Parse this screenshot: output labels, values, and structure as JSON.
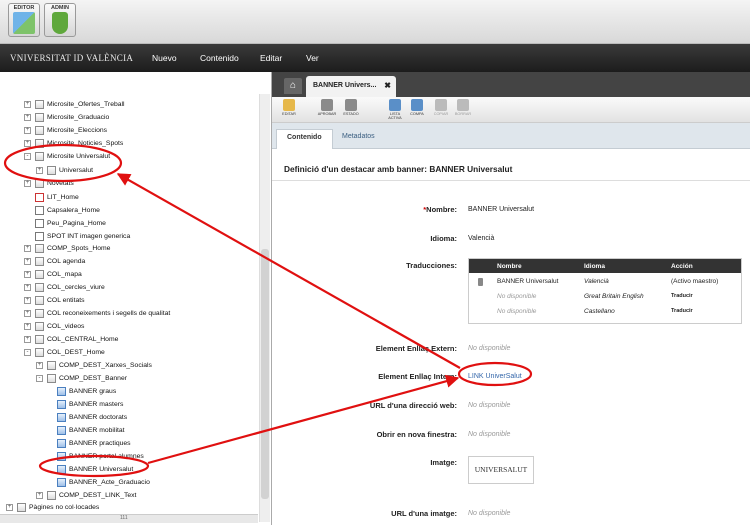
{
  "apps": [
    {
      "label": "EDITOR",
      "icon": "editor-icon"
    },
    {
      "label": "ADMIN",
      "icon": "admin-shield-icon"
    }
  ],
  "brand": "VNIVERSITAT ID VALÈNCIA",
  "menu": [
    "Nuevo",
    "Contenido",
    "Editar",
    "Ver"
  ],
  "tree": [
    {
      "label": "Microsite_Ofertes_Treball",
      "expander": "+",
      "icon": "page"
    },
    {
      "label": "Microsite_Graduacio",
      "expander": "+",
      "icon": "page"
    },
    {
      "label": "Microsite_Eleccions",
      "expander": "+",
      "icon": "page"
    },
    {
      "label": "Microsite_Noticies_Spots",
      "expander": "+",
      "icon": "page"
    },
    {
      "label": "Microsite Universalut",
      "expander": "-",
      "icon": "page"
    },
    {
      "label": "Universalut",
      "expander": "+",
      "icon": "page"
    },
    {
      "label": "Novetats",
      "expander": "+",
      "icon": "page"
    },
    {
      "label": "LIT_Home",
      "expander": "",
      "icon": "red"
    },
    {
      "label": "Capsalera_Home",
      "expander": "",
      "icon": "doc"
    },
    {
      "label": "Peu_Pagina_Home",
      "expander": "",
      "icon": "doc"
    },
    {
      "label": "SPOT INT imagen generica",
      "expander": "",
      "icon": "doc"
    },
    {
      "label": "COMP_Spots_Home",
      "expander": "+",
      "icon": "page"
    },
    {
      "label": "COL agenda",
      "expander": "+",
      "icon": "page"
    },
    {
      "label": "COL_mapa",
      "expander": "+",
      "icon": "page"
    },
    {
      "label": "COL_cercles_viure",
      "expander": "+",
      "icon": "page"
    },
    {
      "label": "COL entitats",
      "expander": "+",
      "icon": "page"
    },
    {
      "label": "COL reconeixements i segells de qualitat",
      "expander": "+",
      "icon": "page"
    },
    {
      "label": "COL_videos",
      "expander": "+",
      "icon": "page"
    },
    {
      "label": "COL_CENTRAL_Home",
      "expander": "+",
      "icon": "page"
    },
    {
      "label": "COL_DEST_Home",
      "expander": "-",
      "icon": "page"
    },
    {
      "label": "COMP_DEST_Xarxes_Socials",
      "expander": "+",
      "icon": "page"
    },
    {
      "label": "COMP_DEST_Banner",
      "expander": "-",
      "icon": "page"
    },
    {
      "label": "BANNER graus",
      "expander": "",
      "icon": "blue"
    },
    {
      "label": "BANNER masters",
      "expander": "",
      "icon": "blue"
    },
    {
      "label": "BANNER doctorats",
      "expander": "",
      "icon": "blue"
    },
    {
      "label": "BANNER mobilitat",
      "expander": "",
      "icon": "blue"
    },
    {
      "label": "BANNER practiques",
      "expander": "",
      "icon": "blue"
    },
    {
      "label": "BANNER portal alumnes",
      "expander": "",
      "icon": "blue"
    },
    {
      "label": "BANNER Universalut",
      "expander": "",
      "icon": "blue"
    },
    {
      "label": "BANNER_Acte_Graduacio",
      "expander": "",
      "icon": "blue"
    },
    {
      "label": "COMP_DEST_LINK_Text",
      "expander": "+",
      "icon": "page"
    },
    {
      "label": "Pàgines no col·locades",
      "expander": "+",
      "icon": "page"
    }
  ],
  "tab": {
    "title": "BANNER Univers...",
    "close": "✖"
  },
  "toolbar": [
    {
      "label": "EDITAR",
      "icon": "pencil-icon",
      "color": "#e6b84a",
      "enabled": true
    },
    {
      "label": "APROBAR",
      "icon": "approve-icon",
      "color": "#8a8a8a",
      "enabled": true
    },
    {
      "label": "ESTADO",
      "icon": "status-icon",
      "color": "#8a8a8a",
      "enabled": true
    },
    {
      "label": "LISTA ACTIVA",
      "icon": "list-icon",
      "color": "#5a8fc8",
      "enabled": true
    },
    {
      "label": "COMPA",
      "icon": "share-icon",
      "color": "#5a8fc8",
      "enabled": true
    },
    {
      "label": "COPIAR",
      "icon": "copy-icon",
      "color": "#bbbbbb",
      "enabled": false
    },
    {
      "label": "BORRAR",
      "icon": "trash-icon",
      "color": "#bbbbbb",
      "enabled": false
    }
  ],
  "subtabs": [
    "Contenido",
    "Metadatos"
  ],
  "form": {
    "title": "Definició d'un destacar amb banner: BANNER Universalut",
    "required_mark": "*",
    "nombre_label": "Nombre:",
    "nombre_value": "BANNER Universalut",
    "idioma_label": "Idioma:",
    "idioma_value": "Valencià",
    "traducciones_label": "Traducciones:",
    "traducciones": {
      "headers": [
        "Nombre",
        "Idioma",
        "Acción"
      ],
      "rows": [
        {
          "nombre": "BANNER Universalut",
          "idioma": "Valencià",
          "accion": "(Activo maestro)"
        },
        {
          "nombre": "No disponible",
          "idioma": "Great Britain English",
          "accion": "Traducir"
        },
        {
          "nombre": "No disponible",
          "idioma": "Castellano",
          "accion": "Traducir"
        }
      ]
    },
    "extern_label": "Element Enllaç Extern:",
    "extern_value": "No disponible",
    "intern_label": "Element Enllaç Intern:",
    "intern_value": "LINK UniverSalut",
    "url_label": "URL d'una direcció web:",
    "url_value": "No disponible",
    "obrir_label": "Obrir en nova finestra:",
    "obrir_value": "No disponible",
    "imatge_label": "Imatge:",
    "imatge_value": "UNIVERSALUT",
    "urlimg_label": "URL d'una imatge:",
    "urlimg_value": "No disponible"
  },
  "scroll_page": "111",
  "annotation_color": "#e01010"
}
